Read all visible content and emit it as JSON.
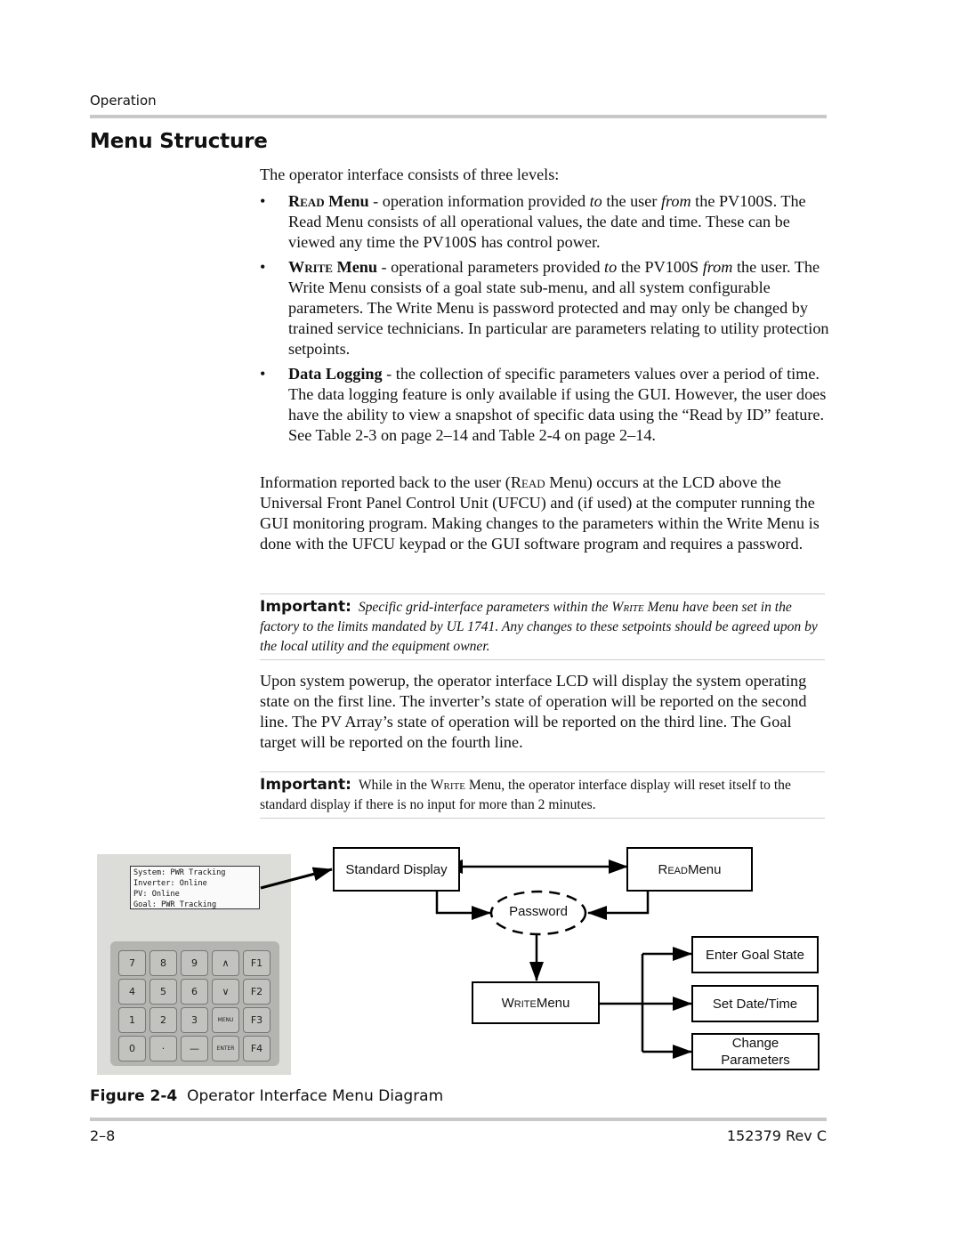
{
  "header": {
    "section": "Operation"
  },
  "title": "Menu Structure",
  "intro": "The operator interface consists of three levels:",
  "bullets": [
    {
      "term_sc": "Read",
      "term_rest": " Menu",
      "dash": " - ",
      "text_a": "operation information provided ",
      "em_a": "to",
      "text_b": " the user ",
      "em_b": "from",
      "text_c": " the PV100S. The Read Menu consists of all operational values, the date and time. These can be viewed any time the PV100S has control power."
    },
    {
      "term_sc": "Write",
      "term_rest": " Menu",
      "dash": " - ",
      "text_a": "operational parameters provided ",
      "em_a": "to",
      "text_b": " the PV100S ",
      "em_b": "from",
      "text_c": " the user. The Write Menu consists of a goal state sub-menu, and all system configurable parameters. The Write Menu is password protected and may only be changed by trained service technicians. In particular are parameters relating to utility protection setpoints."
    },
    {
      "term": "Data Logging",
      "dash": " - ",
      "text": "the collection of specific parameters values over a period of time. The data logging feature is only available if using the GUI. However, the user does have the ability to view a snapshot of specific data using the “Read by ID” feature. See Table 2-3 on page 2–14 and Table 2-4 on page 2–14."
    }
  ],
  "paragraph1": {
    "a": "Information reported back to the user (",
    "sc": "Read",
    "b": " Menu) occurs at the LCD above the Universal Front Panel Control Unit (UFCU) and (if used) at the computer running the GUI monitoring program. Making changes to the parameters within the Write Menu is done with the UFCU keypad or the GUI software program and requires a password."
  },
  "important1": {
    "label": "Important:",
    "a": "Specific grid-interface parameters within the ",
    "sc": "Write",
    "b": " Menu have been set in the factory to the limits mandated by UL 1741. Any changes to these setpoints should be agreed upon by the local utility and the equipment owner."
  },
  "paragraph2": "Upon system powerup, the operator interface LCD will display the system operating state on the first line. The inverter’s state of operation will be reported on the second line. The PV Array’s state of operation will be reported on the third line. The Goal target will be reported on the fourth line.",
  "important2": {
    "label": "Important:",
    "a": "While in the ",
    "sc": "Write",
    "b": " Menu, the operator interface display will reset itself to the standard display if there is no input for more than 2 minutes."
  },
  "lcd": {
    "lines": [
      "System: PWR Tracking",
      "Inverter: Online",
      "PV: Online",
      "Goal: PWR Tracking"
    ]
  },
  "keypad": {
    "keys": [
      "7",
      "8",
      "9",
      "∧",
      "F1",
      "4",
      "5",
      "6",
      "∨",
      "F2",
      "1",
      "2",
      "3",
      "MENU",
      "F3",
      "0",
      "·",
      "—",
      "ENTER",
      "F4"
    ]
  },
  "diagram": {
    "standard_display": "Standard Display",
    "read_menu_sc": "Read",
    "read_menu_rest": " Menu",
    "password": "Password",
    "write_menu_sc": "Write",
    "write_menu_rest": " Menu",
    "enter_goal_state": "Enter Goal State",
    "set_date_time": "Set Date/Time",
    "change_parameters": "Change Parameters"
  },
  "figure_caption": {
    "number": "Figure 2-4",
    "title": "Operator Interface Menu Diagram"
  },
  "footer": {
    "page": "2–8",
    "doc": "152379 Rev C"
  }
}
